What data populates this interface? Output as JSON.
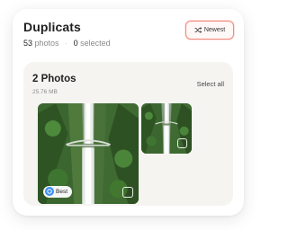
{
  "header": {
    "title": "Duplicats",
    "photo_count": "53",
    "photo_label": "photos",
    "selected_count": "0",
    "selected_label": "selected",
    "sort_label": "Newest",
    "sort_icon": "shuffle-icon"
  },
  "group": {
    "title": "2 Photos",
    "size": "25.76 MB",
    "select_all_label": "Select all",
    "photos": [
      {
        "badge": "Best",
        "badge_icon": "best-badge-icon",
        "checked": false
      },
      {
        "checked": false
      }
    ]
  },
  "colors": {
    "accent": "#f08a7e",
    "badge_blue": "#3d8ef0"
  }
}
